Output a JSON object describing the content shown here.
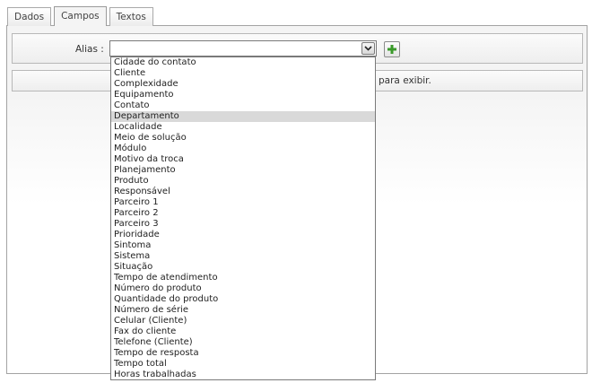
{
  "tabs": [
    {
      "label": "Dados",
      "active": false
    },
    {
      "label": "Campos",
      "active": true
    },
    {
      "label": "Textos",
      "active": false
    }
  ],
  "alias": {
    "label": "Alias :",
    "value": ""
  },
  "icons": {
    "dropdown_arrow": "chevron-down-icon",
    "add": "plus-icon",
    "add_color": "#3a9a2a"
  },
  "message": {
    "visible_text": "para exibir."
  },
  "dropdown": {
    "highlighted": "Departamento",
    "options": [
      "Cidade do contato",
      "Cliente",
      "Complexidade",
      "Equipamento",
      "Contato",
      "Departamento",
      "Localidade",
      "Meio de solução",
      "Módulo",
      "Motivo da troca",
      "Planejamento",
      "Produto",
      "Responsável",
      "Parceiro 1",
      "Parceiro 2",
      "Parceiro 3",
      "Prioridade",
      "Sintoma",
      "Sistema",
      "Situação",
      "Tempo de atendimento",
      "Número do produto",
      "Quantidade do produto",
      "Número de série",
      "Celular (Cliente)",
      "Fax do cliente",
      "Telefone (Cliente)",
      "Tempo de resposta",
      "Tempo total",
      "Horas trabalhadas"
    ]
  }
}
